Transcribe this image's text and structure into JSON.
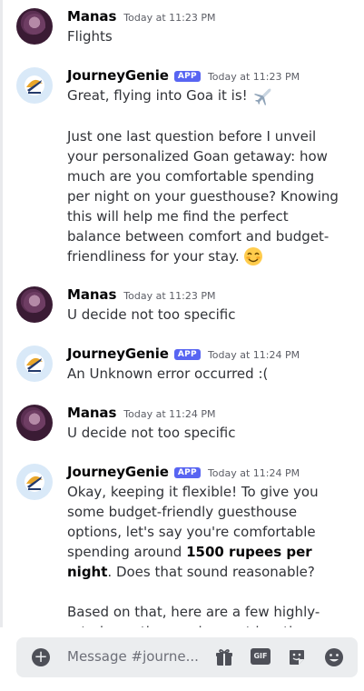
{
  "messages": [
    {
      "author": "Manas",
      "time": "Today at 11:23 PM",
      "lines": [
        "Flights"
      ]
    },
    {
      "author": "JourneyGenie",
      "badge": "APP",
      "time": "Today at 11:23 PM",
      "p1": "Great, flying into Goa it is!",
      "p2": "Just one last question before I unveil your personalized Goan getaway: how much are you comfortable spending per night on your guesthouse? Knowing this will help me find the perfect balance between comfort and budget-friendliness for your stay."
    },
    {
      "author": "Manas",
      "time": "Today at 11:23 PM",
      "lines": [
        "U decide not too specific"
      ]
    },
    {
      "author": "JourneyGenie",
      "badge": "APP",
      "time": "Today at 11:24 PM",
      "lines": [
        "An Unknown error occurred :("
      ]
    },
    {
      "author": "Manas",
      "time": "Today at 11:24 PM",
      "lines": [
        "U decide not too specific"
      ]
    },
    {
      "author": "JourneyGenie",
      "badge": "APP",
      "time": "Today at 11:24 PM",
      "p1a": "Okay, keeping it flexible!  To give you some budget-friendly guesthouse options, let's say you're comfortable spending around ",
      "p1b": "1500 rupees per night",
      "p1c": ". Does that sound reasonable?",
      "p2": "Based on that, here are a few highly-rated guesthouses in great locations for"
    }
  ],
  "composer": {
    "placeholder": "Message #journe...",
    "gif_label": "GIF"
  },
  "colors": {
    "accent": "#5865f2",
    "bg": "#ffffff",
    "composer_bg": "#ebedef"
  }
}
